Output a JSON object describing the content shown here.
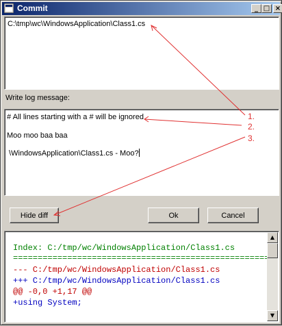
{
  "window": {
    "title": "Commit",
    "controls": {
      "minimize": "_",
      "maximize": "□",
      "close": "×"
    }
  },
  "files": {
    "items": [
      "C:\\tmp\\wc\\WindowsApplication\\Class1.cs"
    ]
  },
  "log_label": "Write log message:",
  "message": {
    "lines": [
      "# All lines starting with a # will be ignored",
      "Moo moo baa baa",
      " \\WindowsApplication\\Class1.cs - Moo?"
    ]
  },
  "buttons": {
    "hide_diff": "Hide diff",
    "ok": "Ok",
    "cancel": "Cancel"
  },
  "diff": {
    "lines": [
      {
        "text": "Index: C:/tmp/wc/WindowsApplication/Class1.cs",
        "color": "#008000"
      },
      {
        "text": "====================================================",
        "color": "#008000"
      },
      {
        "text": "--- C:/tmp/wc/WindowsApplication/Class1.cs",
        "color": "#c00000"
      },
      {
        "text": "+++ C:/tmp/wc/WindowsApplication/Class1.cs",
        "color": "#0000c0"
      },
      {
        "text": "@@ -0,0 +1,17 @@",
        "color": "#c00000"
      },
      {
        "text": "+using System;",
        "color": "#0000c0"
      }
    ]
  },
  "annotations": {
    "numbers": [
      "1.",
      "2.",
      "3."
    ],
    "color": "#e03030"
  }
}
